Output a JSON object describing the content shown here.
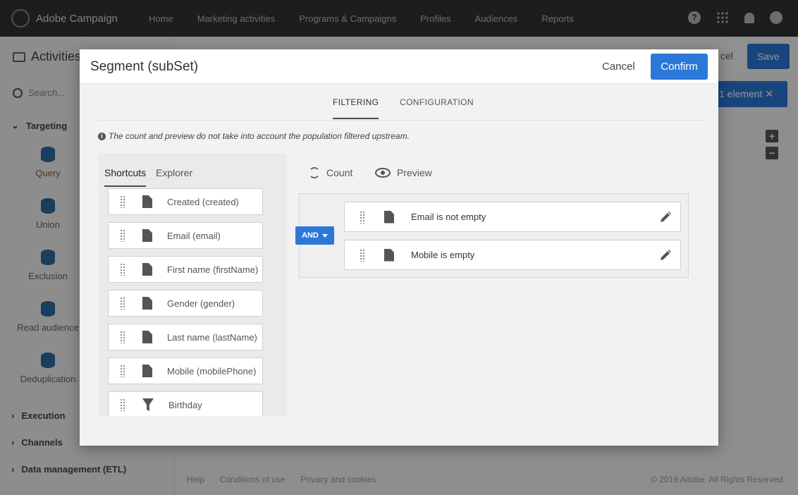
{
  "app": {
    "brand": "Adobe Campaign",
    "nav": [
      "Home",
      "Marketing activities",
      "Programs & Campaigns",
      "Profiles",
      "Audiences",
      "Reports"
    ],
    "help_glyph": "?"
  },
  "sidebar": {
    "title": "Activities",
    "search_placeholder": "Search...",
    "targeting_label": "Targeting",
    "activities": [
      "Query",
      "Union",
      "Exclusion",
      "Read audience",
      "Deduplication"
    ],
    "categories": [
      "Execution",
      "Channels",
      "Data management (ETL)"
    ]
  },
  "workspace": {
    "cancel_fragment": "cel",
    "save_label": "Save",
    "selection_label": "1 element",
    "zoom_in": "+",
    "zoom_out": "−",
    "footer_links": [
      "Help",
      "Conditions of use",
      "Privacy and cookies"
    ],
    "copyright": "© 2019 Adobe. All Rights Reserved."
  },
  "modal": {
    "title": "Segment (subSet)",
    "cancel_label": "Cancel",
    "confirm_label": "Confirm",
    "tabs": [
      "FILTERING",
      "CONFIGURATION"
    ],
    "notice": "The count and preview do not take into account the population filtered upstream.",
    "info_glyph": "i",
    "left_tabs": [
      "Shortcuts",
      "Explorer"
    ],
    "shortcuts": [
      {
        "label": "Created (created)",
        "icon": "document-icon"
      },
      {
        "label": "Email (email)",
        "icon": "document-icon"
      },
      {
        "label": "First name (firstName)",
        "icon": "document-icon"
      },
      {
        "label": "Gender (gender)",
        "icon": "document-icon"
      },
      {
        "label": "Last name (lastName)",
        "icon": "document-icon"
      },
      {
        "label": "Mobile (mobilePhone)",
        "icon": "document-icon"
      },
      {
        "label": "Birthday",
        "icon": "filter-icon"
      }
    ],
    "toolbar": {
      "count": "Count",
      "preview": "Preview"
    },
    "operator": "AND",
    "rules": [
      "Email is not empty",
      "Mobile is empty"
    ]
  },
  "colors": {
    "accent": "#2c78d8",
    "topbar": "#323232"
  }
}
